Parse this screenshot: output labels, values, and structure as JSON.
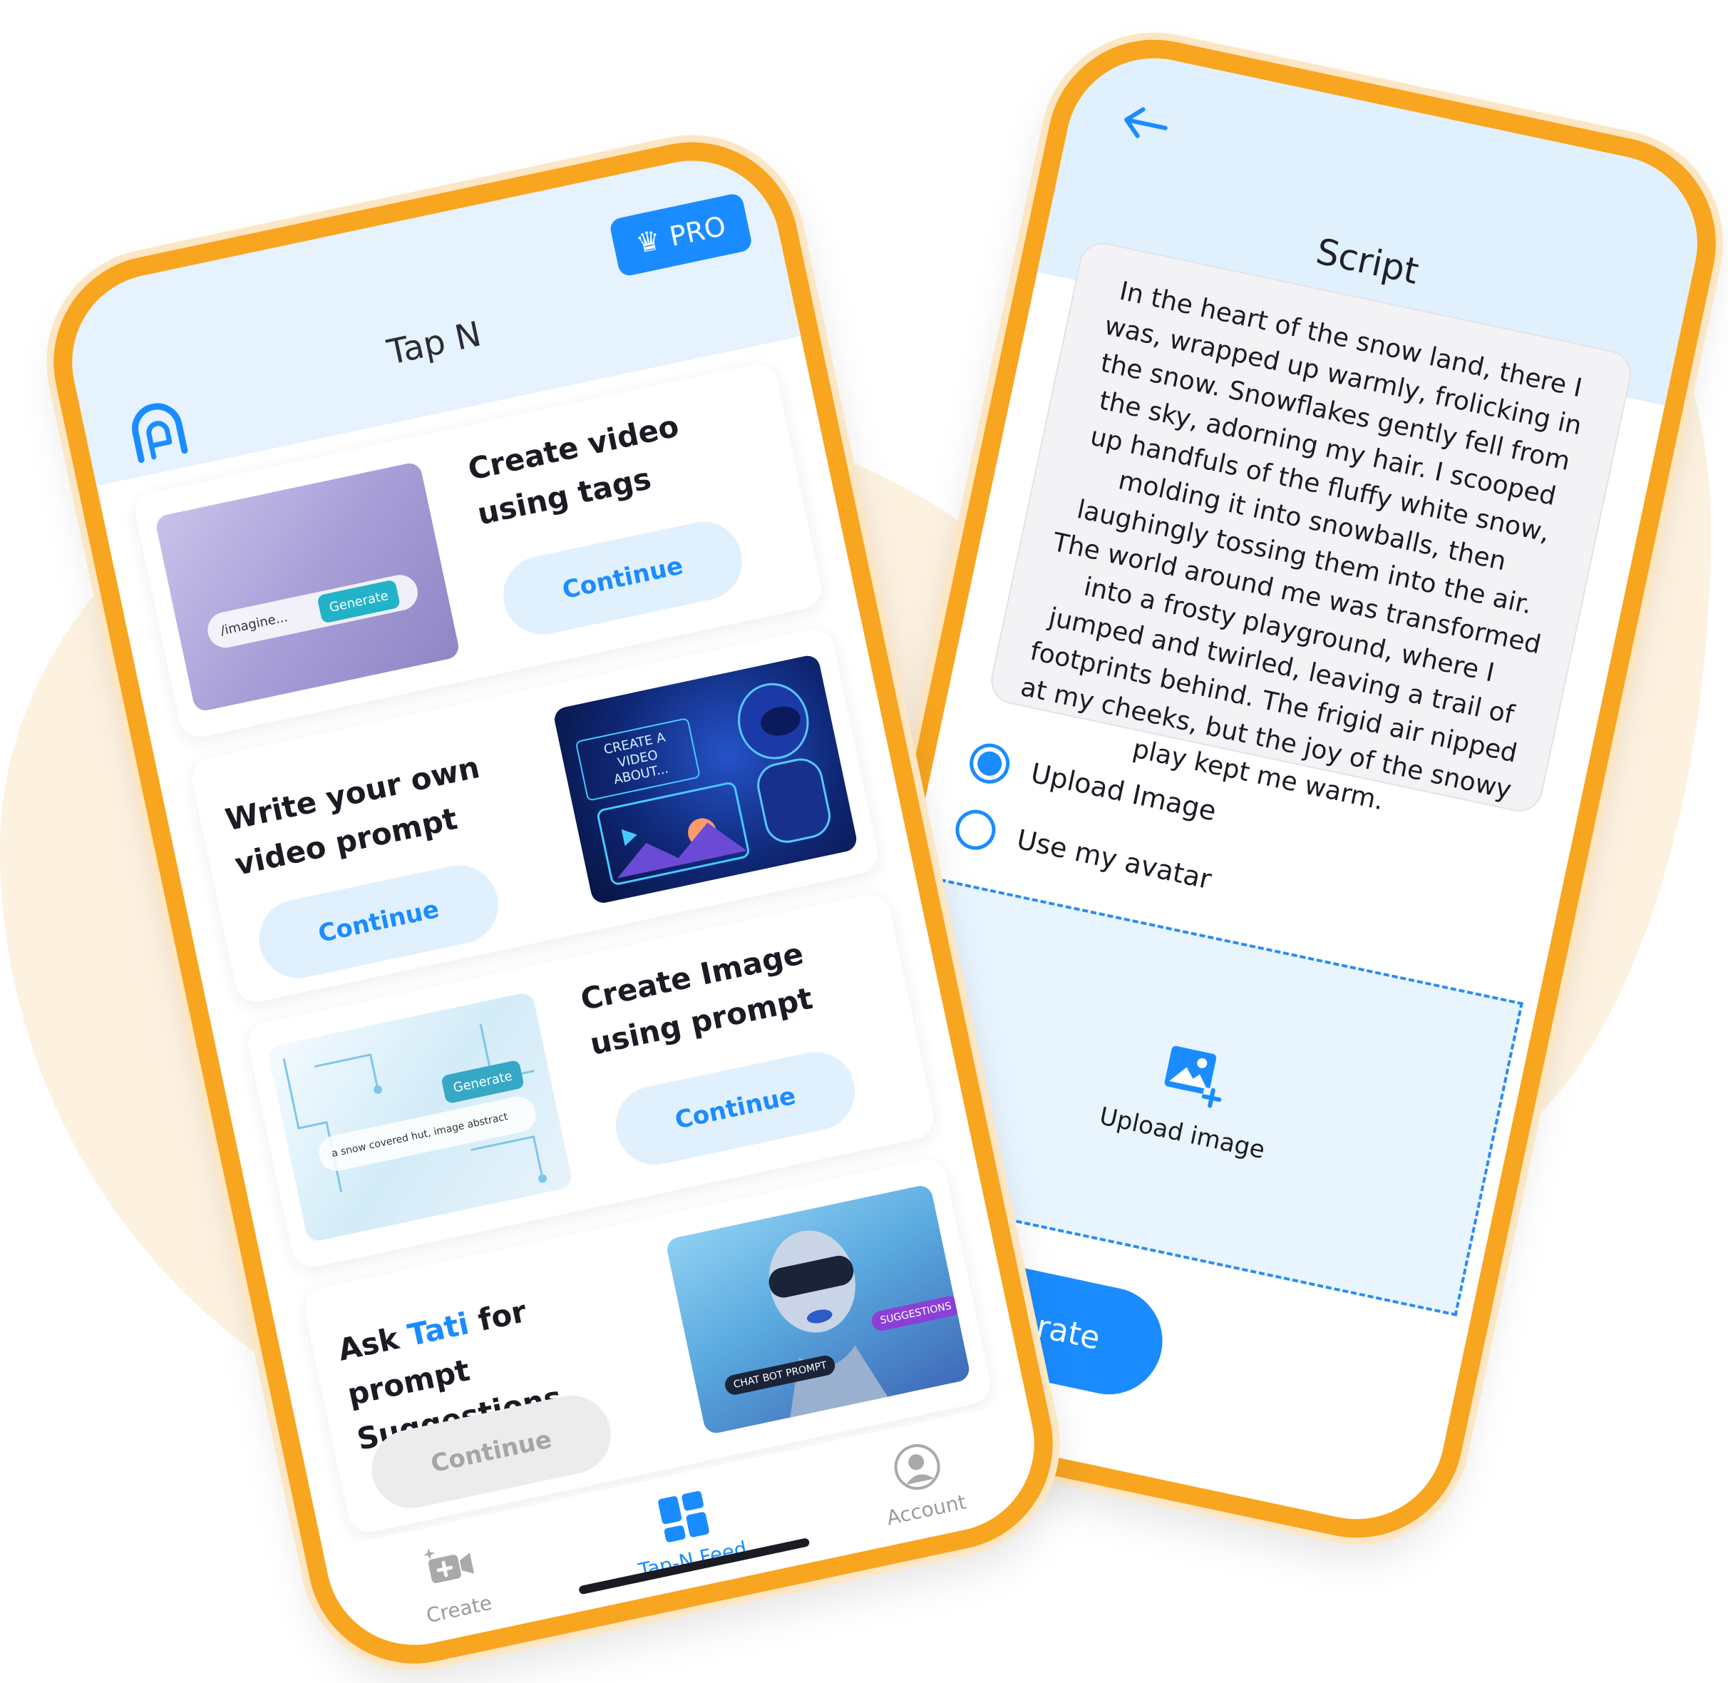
{
  "feed_screen": {
    "app_title": "Tap N",
    "pro_badge": "PRO",
    "cards": [
      {
        "title": "Create video using tags",
        "button": "Continue",
        "thumb_prompt": "/imagine...",
        "thumb_button": "Generate"
      },
      {
        "title": "Write your own video prompt",
        "button": "Continue",
        "thumb_caption": "CREATE A VIDEO ABOUT..."
      },
      {
        "title": "Create Image using prompt",
        "button": "Continue",
        "thumb_prompt": "a snow covered hut, image abstract",
        "thumb_button": "Generate"
      },
      {
        "title_before": "Ask ",
        "title_accent": "Tati",
        "title_after": " for prompt Suggestions",
        "button": "Continue",
        "thumb_chip_1": "CHAT BOT PROMPT",
        "thumb_chip_2": "SUGGESTIONS"
      }
    ],
    "nav": {
      "create": "Create",
      "feed": "Tap-N Feed",
      "account": "Account"
    }
  },
  "script_screen": {
    "title": "Script",
    "script_text": "In the heart of the snow land, there I was, wrapped up warmly, frolicking in the snow. Snowflakes gently fell from the sky, adorning my hair. I scooped up handfuls of the fluffy white snow, molding it into snowballs, then laughingly tossing them into the air. The world around me was transformed into a frosty playground, where I jumped and twirled, leaving a trail of footprints behind. The frigid air nipped at my cheeks, but the joy of the snowy play kept me warm.",
    "options": {
      "upload_image": "Upload Image",
      "use_avatar": "Use my avatar",
      "selected": "upload_image"
    },
    "upload_zone_label": "Upload image",
    "generate_button": "Generate"
  },
  "colors": {
    "accent": "#1a8cff",
    "frame": "#f8a51f",
    "background_blob": "#fdf1e0"
  }
}
